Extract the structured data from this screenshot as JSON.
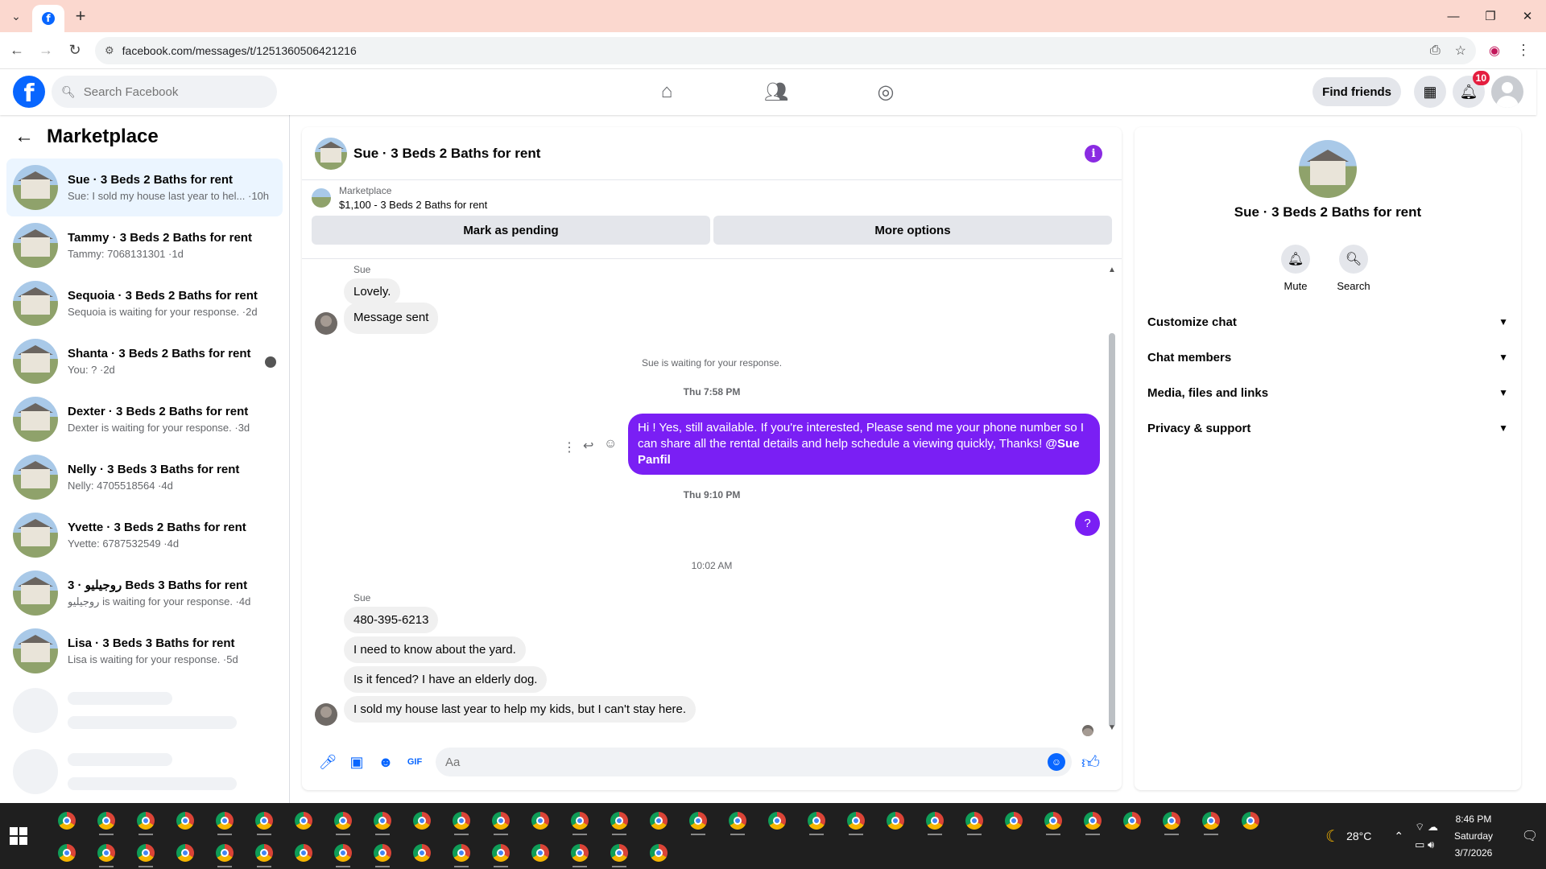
{
  "browser": {
    "url": "facebook.com/messages/t/1251360506421216",
    "favicon": "facebook-favicon"
  },
  "header": {
    "search_placeholder": "Search Facebook",
    "find_friends": "Find friends",
    "notifications_count": "10"
  },
  "sidebar": {
    "title": "Marketplace",
    "conversations": [
      {
        "name": "Sue · 3 Beds 2 Baths for rent",
        "preview": "Sue: I sold my house last year to hel... ·10h",
        "active": true
      },
      {
        "name": "Tammy · 3 Beds 2 Baths for rent",
        "preview": "Tammy: 7068131301 ·1d"
      },
      {
        "name": "Sequoia · 3 Beds 2 Baths for rent",
        "preview": "Sequoia is waiting for your response. ·2d"
      },
      {
        "name": "Shanta · 3 Beds 2 Baths for rent",
        "preview": "You: ? ·2d"
      },
      {
        "name": "Dexter · 3 Beds 2 Baths for rent",
        "preview": "Dexter is waiting for your response. ·3d"
      },
      {
        "name": "Nelly · 3 Beds 3 Baths for rent",
        "preview": "Nelly: 4705518564 ·4d"
      },
      {
        "name": "Yvette · 3 Beds 2 Baths for rent",
        "preview": "Yvette: 6787532549 ·4d"
      },
      {
        "name": "روجيليو · 3 Beds 3 Baths for rent",
        "preview": "روجيليو is waiting for your response. ·4d"
      },
      {
        "name": "Lisa · 3 Beds 3 Baths for rent",
        "preview": "Lisa is waiting for your response. ·5d"
      }
    ]
  },
  "chat": {
    "title": "Sue · 3 Beds 2 Baths for rent",
    "marketplace_label": "Marketplace",
    "listing": "$1,100 - 3 Beds 2 Baths for rent",
    "mark_pending": "Mark as pending",
    "more_options": "More options",
    "sender_1": "Sue",
    "msg_lovely": "Lovely.",
    "msg_sent": "Message sent",
    "waiting": "Sue is waiting for your response.",
    "time_1": "Thu 7:58 PM",
    "out_msg_1": "Hi ! Yes, still available. If you're interested, Please send me your phone number so I can share all the rental details and help schedule a viewing quickly, Thanks!",
    "out_mention": "@Sue Panfil",
    "time_2": "Thu 9:10 PM",
    "out_msg_2": "?",
    "time_3": "10:02 AM",
    "sender_2": "Sue",
    "msg_phone": "480-395-6213",
    "msg_yard": "I need to know about the yard.",
    "msg_fenced": "Is it fenced? I have an elderly dog.",
    "msg_sold": "I sold my house last year to help my kids, but I  can't stay here.",
    "composer_placeholder": "Aa"
  },
  "info_panel": {
    "name": "Sue · 3 Beds 2 Baths for rent",
    "mute": "Mute",
    "search": "Search",
    "sections": [
      "Customize chat",
      "Chat members",
      "Media, files and links",
      "Privacy & support"
    ]
  },
  "taskbar": {
    "temperature": "28°C",
    "time": "8:46 PM",
    "day": "Saturday",
    "date": "3/7/2026"
  }
}
